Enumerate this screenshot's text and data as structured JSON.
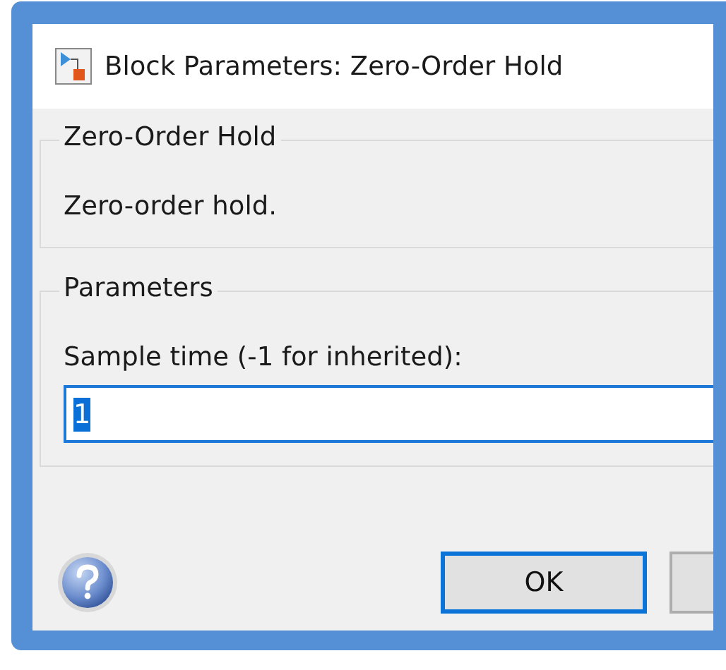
{
  "window": {
    "title": "Block Parameters: Zero-Order Hold"
  },
  "description_group": {
    "title": "Zero-Order Hold",
    "text": "Zero-order hold."
  },
  "parameters_group": {
    "title": "Parameters",
    "fields": [
      {
        "label": "Sample time (-1 for inherited):",
        "value": "1",
        "focused": true,
        "value_selected": true
      }
    ]
  },
  "buttons": [
    {
      "label": "OK",
      "default": true
    },
    {
      "default": false
    }
  ]
}
